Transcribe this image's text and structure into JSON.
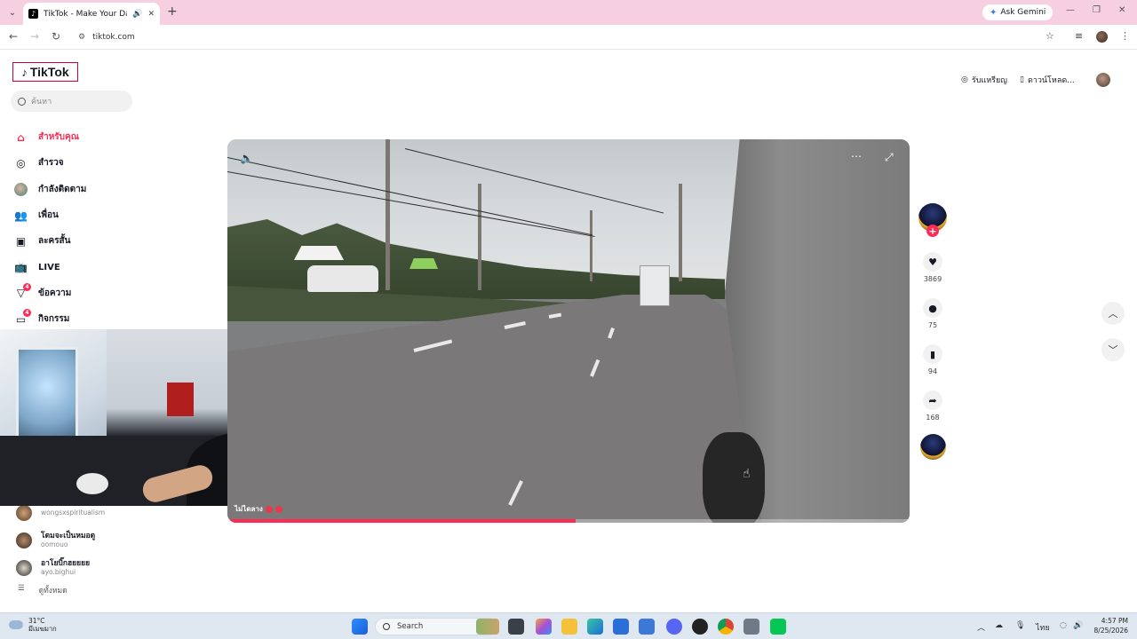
{
  "browser": {
    "tab_title": "TikTok - Make Your Day",
    "tab_favicon": "tiktok-icon",
    "new_tab_label": "+",
    "ask_gemini": "Ask Gemini",
    "url": "tiktok.com"
  },
  "tiktok": {
    "logo": "TikTok",
    "search_placeholder": "ค้นหา",
    "nav": [
      {
        "label": "สำหรับคุณ",
        "icon": "home-icon",
        "active": true
      },
      {
        "label": "สำรวจ",
        "icon": "compass-icon"
      },
      {
        "label": "กำลังติดตาม",
        "icon": "following-avatar-icon"
      },
      {
        "label": "เพื่อน",
        "icon": "friends-icon"
      },
      {
        "label": "ละครสั้น",
        "icon": "drama-icon"
      },
      {
        "label": "LIVE",
        "icon": "live-icon"
      },
      {
        "label": "ข้อความ",
        "icon": "message-icon",
        "badge": "4"
      },
      {
        "label": "กิจกรรม",
        "icon": "activity-icon",
        "badge": "4"
      }
    ],
    "following_accounts": [
      {
        "name": "",
        "handle": "wongsxspiritualism"
      },
      {
        "name": "โดมจะเป็นหมอดู",
        "handle": "oomouo"
      },
      {
        "name": "อาโยบิ๊กฮยยยย",
        "handle": "ayo.bighui"
      }
    ],
    "see_all": "ดูทั้งหมด",
    "top_right": {
      "rewards": "รับแหรียญ",
      "download": "ดาวน์โหลด..."
    },
    "video": {
      "caption": "ไม่ไดลาง",
      "progress": 0.51
    },
    "actions": {
      "likes": "3869",
      "comments": "75",
      "saves": "94",
      "shares": "168"
    }
  },
  "taskbar": {
    "temperature": "31°C",
    "weather_desc": "มีเมฆมาก",
    "search": "Search",
    "time": "4:57 PM",
    "date": "8/25/2026",
    "lang": "ไทย"
  },
  "colors": {
    "tab_strip": "#f6cfe1",
    "accent": "#fe2c55",
    "taskbar": "#dfe7f0"
  }
}
